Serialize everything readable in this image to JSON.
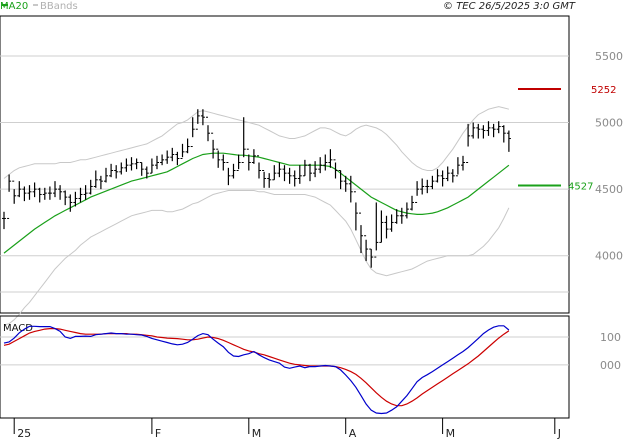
{
  "header": {
    "legend": [
      {
        "label": "MA20",
        "color": "#1aa01a"
      },
      {
        "label": "BBands",
        "color": "#c8c8c8"
      }
    ],
    "copyright": "© TEC 26/5/2025 3:0 GMT"
  },
  "chart_data": [
    {
      "type": "line",
      "name": "price",
      "y_ticks": [
        {
          "value": 4000,
          "label": "4000"
        },
        {
          "value": 4500,
          "label": "4500"
        },
        {
          "value": 5000,
          "label": "5000"
        },
        {
          "value": 5500,
          "label": "5500"
        }
      ],
      "ylim": [
        3570,
        5800
      ],
      "x_ticks": [
        {
          "label": "25",
          "index": 2
        },
        {
          "label": "F",
          "index": 29
        },
        {
          "label": "M",
          "index": 48
        },
        {
          "label": "A",
          "index": 67
        },
        {
          "label": "M",
          "index": 86
        },
        {
          "label": "J",
          "index": 108
        }
      ],
      "levels": [
        {
          "label": "5252",
          "value": 5252,
          "color": "#c00000"
        },
        {
          "label": "4527",
          "value": 4527,
          "color": "#1aa01a"
        }
      ],
      "close": [
        4280,
        4560,
        4450,
        4500,
        4470,
        4480,
        4500,
        4460,
        4470,
        4470,
        4500,
        4480,
        4440,
        4400,
        4430,
        4460,
        4470,
        4520,
        4570,
        4560,
        4600,
        4640,
        4630,
        4660,
        4680,
        4690,
        4700,
        4650,
        4620,
        4680,
        4700,
        4720,
        4740,
        4760,
        4730,
        4780,
        4820,
        4950,
        5050,
        5040,
        4920,
        4800,
        4720,
        4700,
        4600,
        4640,
        4700,
        4800,
        4700,
        4750,
        4640,
        4580,
        4570,
        4620,
        4650,
        4620,
        4600,
        4580,
        4600,
        4680,
        4620,
        4650,
        4680,
        4700,
        4720,
        4640,
        4560,
        4540,
        4480,
        4320,
        4150,
        4050,
        3990,
        4100,
        4250,
        4200,
        4250,
        4300,
        4300,
        4350,
        4400,
        4500,
        4520,
        4520,
        4560,
        4600,
        4580,
        4620,
        4600,
        4680,
        4700,
        4900,
        4960,
        4950,
        4940,
        4960,
        4950,
        4970,
        4920,
        4880
      ],
      "high": [
        4330,
        4610,
        4500,
        4560,
        4520,
        4530,
        4550,
        4510,
        4510,
        4520,
        4560,
        4530,
        4490,
        4460,
        4480,
        4510,
        4530,
        4570,
        4640,
        4600,
        4660,
        4690,
        4680,
        4700,
        4730,
        4740,
        4730,
        4700,
        4670,
        4730,
        4750,
        4760,
        4790,
        4810,
        4780,
        4840,
        4880,
        5040,
        5100,
        5100,
        4980,
        4870,
        4790,
        4760,
        4660,
        4690,
        4760,
        5040,
        4760,
        4800,
        4700,
        4630,
        4620,
        4680,
        4700,
        4680,
        4660,
        4640,
        4680,
        4720,
        4690,
        4710,
        4740,
        4760,
        4800,
        4700,
        4640,
        4600,
        4600,
        4400,
        4230,
        4120,
        4050,
        4400,
        4340,
        4300,
        4310,
        4350,
        4360,
        4400,
        4450,
        4560,
        4580,
        4570,
        4600,
        4650,
        4640,
        4670,
        4650,
        4740,
        4750,
        4990,
        5000,
        4990,
        4980,
        5010,
        4990,
        5010,
        4980,
        4940
      ],
      "low": [
        4200,
        4480,
        4390,
        4440,
        4410,
        4420,
        4440,
        4400,
        4420,
        4420,
        4440,
        4420,
        4380,
        4330,
        4370,
        4400,
        4420,
        4460,
        4510,
        4500,
        4550,
        4590,
        4580,
        4610,
        4630,
        4640,
        4650,
        4600,
        4580,
        4620,
        4650,
        4680,
        4690,
        4710,
        4680,
        4740,
        4770,
        4890,
        4990,
        4980,
        4860,
        4730,
        4660,
        4640,
        4530,
        4580,
        4650,
        4740,
        4640,
        4690,
        4580,
        4510,
        4510,
        4570,
        4590,
        4560,
        4540,
        4520,
        4540,
        4600,
        4560,
        4590,
        4620,
        4640,
        4660,
        4580,
        4500,
        4480,
        4400,
        4190,
        4020,
        3960,
        3910,
        4040,
        4100,
        4130,
        4180,
        4240,
        4240,
        4280,
        4340,
        4450,
        4460,
        4470,
        4500,
        4550,
        4520,
        4560,
        4550,
        4610,
        4640,
        4820,
        4880,
        4880,
        4880,
        4900,
        4890,
        4920,
        4850,
        4780
      ],
      "ma20": [
        4020,
        4050,
        4080,
        4110,
        4140,
        4170,
        4200,
        4225,
        4250,
        4275,
        4300,
        4320,
        4340,
        4360,
        4380,
        4400,
        4420,
        4440,
        4455,
        4470,
        4485,
        4500,
        4515,
        4530,
        4545,
        4560,
        4570,
        4580,
        4590,
        4600,
        4610,
        4620,
        4630,
        4650,
        4670,
        4690,
        4710,
        4730,
        4745,
        4760,
        4765,
        4770,
        4770,
        4770,
        4765,
        4760,
        4755,
        4755,
        4750,
        4745,
        4740,
        4730,
        4720,
        4710,
        4700,
        4690,
        4680,
        4680,
        4680,
        4680,
        4680,
        4680,
        4680,
        4675,
        4670,
        4650,
        4620,
        4590,
        4560,
        4530,
        4500,
        4470,
        4440,
        4420,
        4400,
        4380,
        4360,
        4340,
        4330,
        4320,
        4315,
        4310,
        4310,
        4315,
        4320,
        4330,
        4345,
        4360,
        4380,
        4400,
        4420,
        4440,
        4470,
        4500,
        4530,
        4560,
        4590,
        4620,
        4650,
        4680
      ],
      "bb_upper": [
        4580,
        4610,
        4640,
        4660,
        4670,
        4680,
        4690,
        4690,
        4690,
        4690,
        4690,
        4700,
        4700,
        4700,
        4710,
        4720,
        4720,
        4730,
        4740,
        4750,
        4760,
        4770,
        4780,
        4790,
        4800,
        4810,
        4820,
        4830,
        4840,
        4860,
        4880,
        4900,
        4930,
        4960,
        4990,
        5000,
        5020,
        5050,
        5080,
        5090,
        5080,
        5070,
        5060,
        5050,
        5040,
        5030,
        5020,
        5010,
        5000,
        4990,
        4980,
        4960,
        4940,
        4920,
        4900,
        4890,
        4880,
        4880,
        4890,
        4900,
        4920,
        4940,
        4960,
        4960,
        4950,
        4930,
        4910,
        4900,
        4920,
        4950,
        4970,
        4980,
        4970,
        4960,
        4940,
        4910,
        4870,
        4830,
        4780,
        4740,
        4700,
        4670,
        4650,
        4640,
        4640,
        4660,
        4700,
        4750,
        4800,
        4860,
        4920,
        4970,
        5020,
        5060,
        5080,
        5100,
        5110,
        5120,
        5110,
        5100
      ],
      "bb_lower": [
        3480,
        3490,
        3520,
        3560,
        3610,
        3650,
        3700,
        3750,
        3800,
        3850,
        3900,
        3940,
        3980,
        4010,
        4040,
        4080,
        4110,
        4140,
        4160,
        4180,
        4200,
        4220,
        4240,
        4260,
        4280,
        4300,
        4310,
        4320,
        4330,
        4340,
        4340,
        4340,
        4330,
        4330,
        4340,
        4350,
        4370,
        4390,
        4400,
        4420,
        4440,
        4460,
        4470,
        4480,
        4490,
        4490,
        4490,
        4490,
        4490,
        4490,
        4480,
        4480,
        4470,
        4460,
        4460,
        4460,
        4460,
        4460,
        4460,
        4460,
        4450,
        4440,
        4420,
        4400,
        4380,
        4340,
        4300,
        4260,
        4200,
        4120,
        4040,
        3960,
        3900,
        3870,
        3860,
        3850,
        3860,
        3870,
        3880,
        3890,
        3900,
        3920,
        3940,
        3960,
        3970,
        3980,
        3990,
        4000,
        4000,
        4000,
        4000,
        4000,
        4010,
        4040,
        4070,
        4110,
        4160,
        4210,
        4280,
        4360
      ]
    },
    {
      "type": "line",
      "name": "MACD",
      "title": "MACD",
      "y_ticks": [
        {
          "value": 100,
          "label": "100"
        },
        {
          "value": 0,
          "label": "000"
        }
      ],
      "ylim": [
        -190,
        175
      ],
      "macd": [
        78,
        82,
        96,
        115,
        128,
        138,
        138,
        137,
        137,
        137,
        130,
        120,
        100,
        95,
        102,
        102,
        103,
        102,
        108,
        110,
        112,
        114,
        112,
        112,
        110,
        110,
        108,
        107,
        102,
        95,
        90,
        85,
        80,
        75,
        72,
        74,
        80,
        92,
        105,
        112,
        108,
        92,
        78,
        65,
        45,
        32,
        30,
        36,
        40,
        48,
        36,
        26,
        18,
        12,
        6,
        -8,
        -12,
        -8,
        -4,
        -10,
        -6,
        -6,
        -4,
        -2,
        -4,
        -6,
        -18,
        -36,
        -56,
        -80,
        -110,
        -140,
        -162,
        -172,
        -174,
        -172,
        -162,
        -150,
        -130,
        -110,
        -85,
        -60,
        -45,
        -35,
        -24,
        -12,
        0,
        12,
        24,
        36,
        48,
        62,
        78,
        95,
        112,
        125,
        135,
        140,
        140,
        125
      ],
      "signal": [
        70,
        74,
        84,
        94,
        104,
        114,
        120,
        124,
        128,
        130,
        130,
        128,
        124,
        120,
        116,
        112,
        110,
        110,
        110,
        110,
        112,
        112,
        112,
        112,
        112,
        110,
        110,
        108,
        106,
        104,
        100,
        98,
        96,
        95,
        94,
        92,
        90,
        90,
        92,
        96,
        100,
        98,
        94,
        88,
        80,
        72,
        64,
        56,
        50,
        46,
        40,
        36,
        30,
        24,
        18,
        12,
        6,
        2,
        0,
        -2,
        -4,
        -4,
        -4,
        -4,
        -4,
        -6,
        -10,
        -16,
        -24,
        -34,
        -48,
        -64,
        -82,
        -100,
        -116,
        -130,
        -140,
        -146,
        -146,
        -140,
        -130,
        -118,
        -104,
        -92,
        -80,
        -68,
        -56,
        -44,
        -32,
        -20,
        -8,
        4,
        18,
        32,
        48,
        64,
        80,
        96,
        110,
        122
      ]
    }
  ]
}
